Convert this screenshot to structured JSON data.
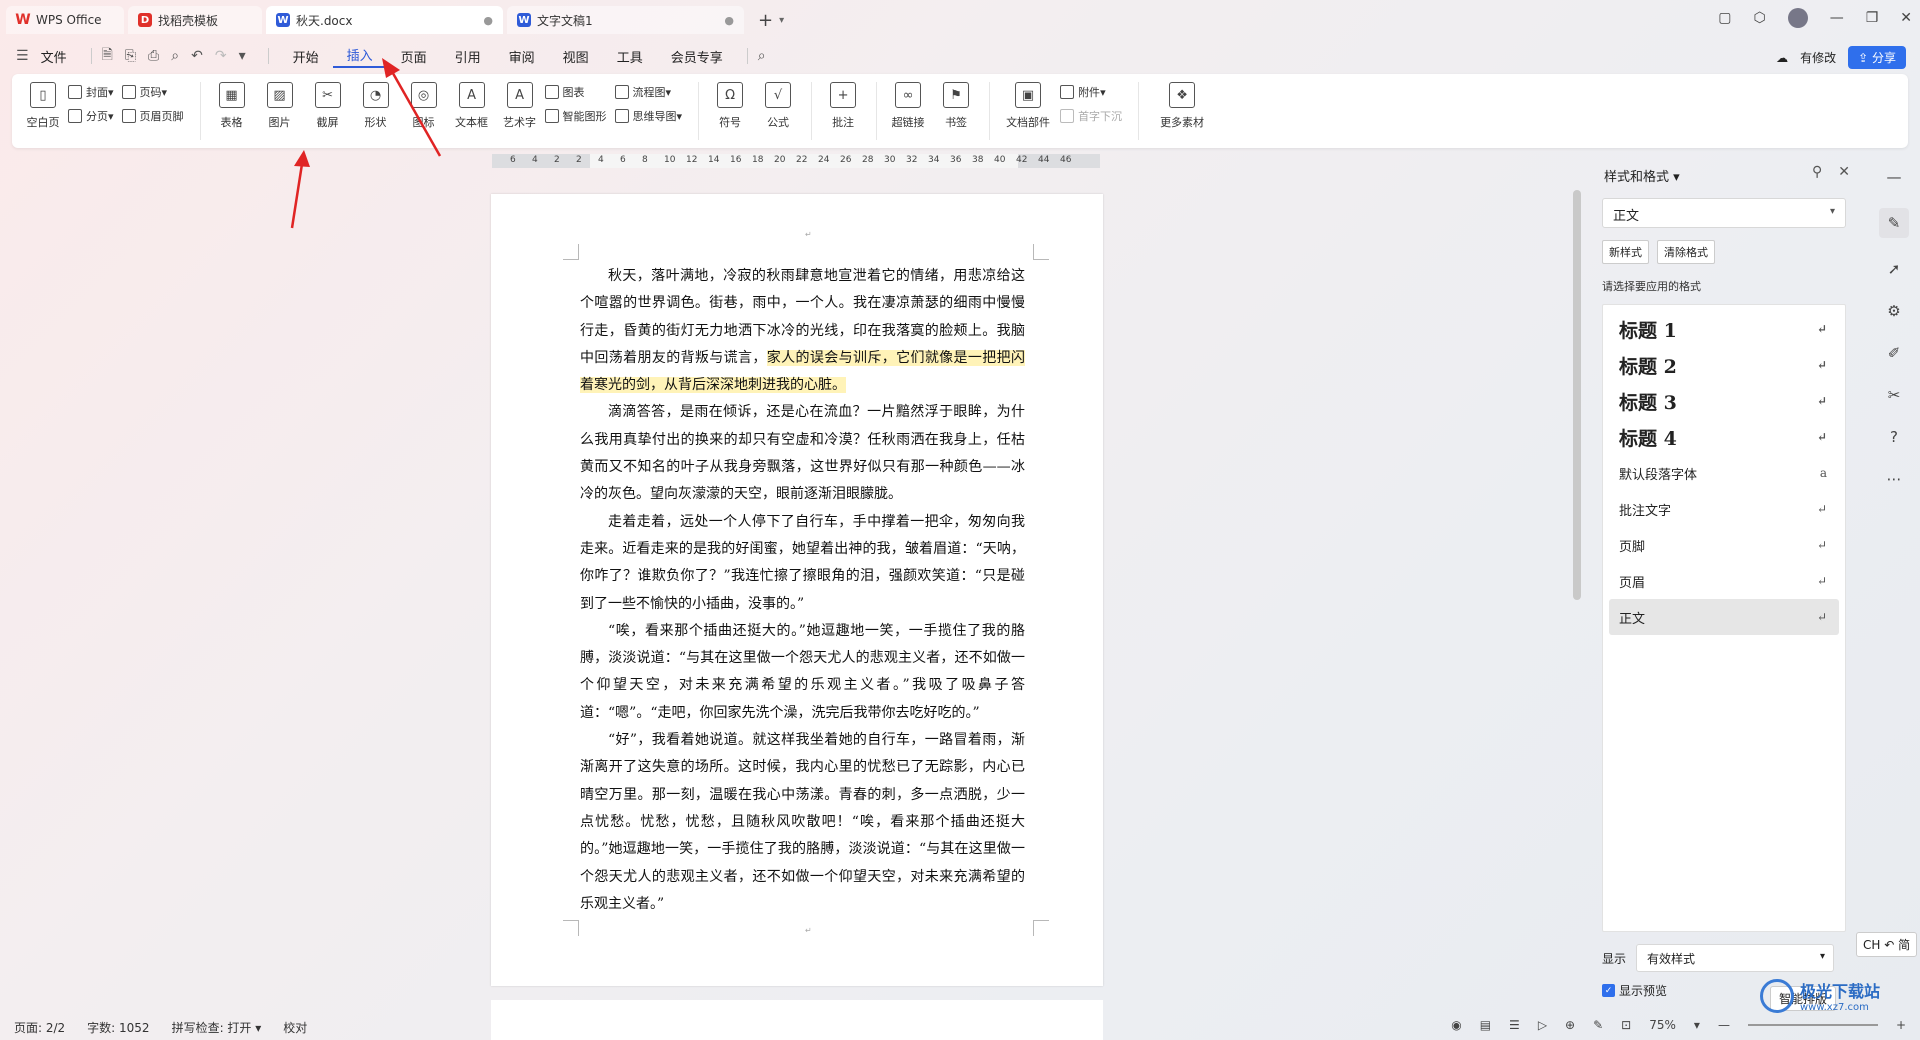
{
  "tabs": [
    {
      "label": "WPS Office",
      "kind": "home"
    },
    {
      "label": "找稻壳模板",
      "kind": "template"
    },
    {
      "label": "秋天.docx",
      "kind": "doc",
      "active": true,
      "status": "●"
    },
    {
      "label": "文字文稿1",
      "kind": "doc",
      "status": "●"
    }
  ],
  "tab_add": "+",
  "menu": {
    "file": "文件",
    "items": [
      "开始",
      "插入",
      "页面",
      "引用",
      "审阅",
      "视图",
      "工具",
      "会员专享"
    ],
    "active": "插入"
  },
  "menu_right": {
    "has_changes": "有修改",
    "share": "分享"
  },
  "ribbon": {
    "pages": {
      "blank_page": "空白页",
      "cover": "封面",
      "page_break": "分页",
      "page_number": "页码",
      "header_footer": "页眉页脚"
    },
    "table": "表格",
    "picture": "图片",
    "screenshot": "截屏",
    "shape": "形状",
    "icon": "图标",
    "textbox": "文本框",
    "wordart": "艺术字",
    "chart": "图表",
    "smart_graphic": "智能图形",
    "flowchart": "流程图",
    "mindmap": "思维导图",
    "symbol": "符号",
    "formula": "公式",
    "comment": "批注",
    "hyperlink": "超链接",
    "bookmark": "书签",
    "doc_parts": "文档部件",
    "attachment": "附件",
    "drop_cap": "首字下沉",
    "more_material": "更多素材"
  },
  "ruler_labels": [
    "6",
    "4",
    "2",
    "2",
    "4",
    "6",
    "8",
    "10",
    "12",
    "14",
    "16",
    "18",
    "20",
    "22",
    "24",
    "26",
    "28",
    "30",
    "32",
    "34",
    "36",
    "38",
    "40",
    "42",
    "44",
    "46"
  ],
  "document": {
    "paragraphs": [
      {
        "before": "秋天，落叶满地，冷寂的秋雨肆意地宣泄着它的情绪，用悲凉给这个喧嚣的世界调色。街巷，雨中，一个人。我在凄凉萧瑟的细雨中慢慢行走，昏黄的街灯无力地洒下冰冷的光线，印在我落寞的脸颊上。我脑中回荡着朋友的背叛与谎言，",
        "highlight": "家人的误会与训斥，它们就像是一把把闪着寒光的剑，从背后深深地刺进我的心脏。"
      },
      {
        "before": "滴滴答答，是雨在倾诉，还是心在流血？一片黯然浮于眼眸，为什么我用真挚付出的换来的却只有空虚和冷漠？任秋雨洒在我身上，任枯黄而又不知名的叶子从我身旁飘落，这世界好似只有那一种颜色——冰冷的灰色。望向灰濛濛的天空，眼前逐渐泪眼朦胧。",
        "highlight": ""
      },
      {
        "before": "走着走着，远处一个人停下了自行车，手中撑着一把伞，匆匆向我走来。近看走来的是我的好闺蜜，她望着出神的我，皱着眉道：“天呐，你咋了？谁欺负你了？”我连忙擦了擦眼角的泪，强颜欢笑道：“只是碰到了一些不愉快的小插曲，没事的。”",
        "highlight": ""
      },
      {
        "before": "“唉，看来那个插曲还挺大的。”她逗趣地一笑，一手揽住了我的胳膊，淡淡说道：“与其在这里做一个怨天尤人的悲观主义者，还不如做一个仰望天空，对未来充满希望的乐观主义者。”我吸了吸鼻子答道：“嗯”。“走吧，你回家先洗个澡，洗完后我带你去吃好吃的。”",
        "highlight": ""
      },
      {
        "before": "“好”，我看着她说道。就这样我坐着她的自行车，一路冒着雨，渐渐离开了这失意的场所。这时候，我内心里的忧愁已了无踪影，内心已晴空万里。那一刻，温暖在我心中荡漾。青春的刺，多一点洒脱，少一点忧愁。忧愁，忧愁，且随秋风吹散吧！“唉，看来那个插曲还挺大的。”她逗趣地一笑，一手揽住了我的胳膊，淡淡说道：“与其在这里做一个怨天尤人的悲观主义者，还不如做一个仰望天空，对未来充满希望的乐观主义者。”",
        "highlight": ""
      }
    ]
  },
  "styles_panel": {
    "title": "样式和格式",
    "current_style": "正文",
    "new_style": "新样式",
    "clear_format": "清除格式",
    "choose_label": "请选择要应用的格式",
    "styles": [
      {
        "name": "标题  1",
        "kind": "heading"
      },
      {
        "name": "标题  2",
        "kind": "heading"
      },
      {
        "name": "标题  3",
        "kind": "heading"
      },
      {
        "name": "标题  4",
        "kind": "heading"
      },
      {
        "name": "默认段落字体",
        "kind": "normal"
      },
      {
        "name": "批注文字",
        "kind": "normal"
      },
      {
        "name": "页脚",
        "kind": "normal"
      },
      {
        "name": "页眉",
        "kind": "normal"
      },
      {
        "name": "正文",
        "kind": "normal",
        "selected": true
      }
    ],
    "show_label": "显示",
    "show_value": "有效样式",
    "preview_label": "显示预览",
    "smart_layout": "智能排版"
  },
  "ime": "CH ↶ 简",
  "status": {
    "page": "页面: 2/2",
    "words": "字数: 1052",
    "spellcheck": "拼写检查: 打开",
    "proofread": "校对",
    "zoom": "75%"
  },
  "watermark": {
    "title": "极光下载站",
    "url": "www.xz7.com"
  },
  "colors": {
    "accent": "#2f5bd8",
    "share": "#2f6fec",
    "highlight": "#fff3b8",
    "arrow": "#e02424"
  }
}
